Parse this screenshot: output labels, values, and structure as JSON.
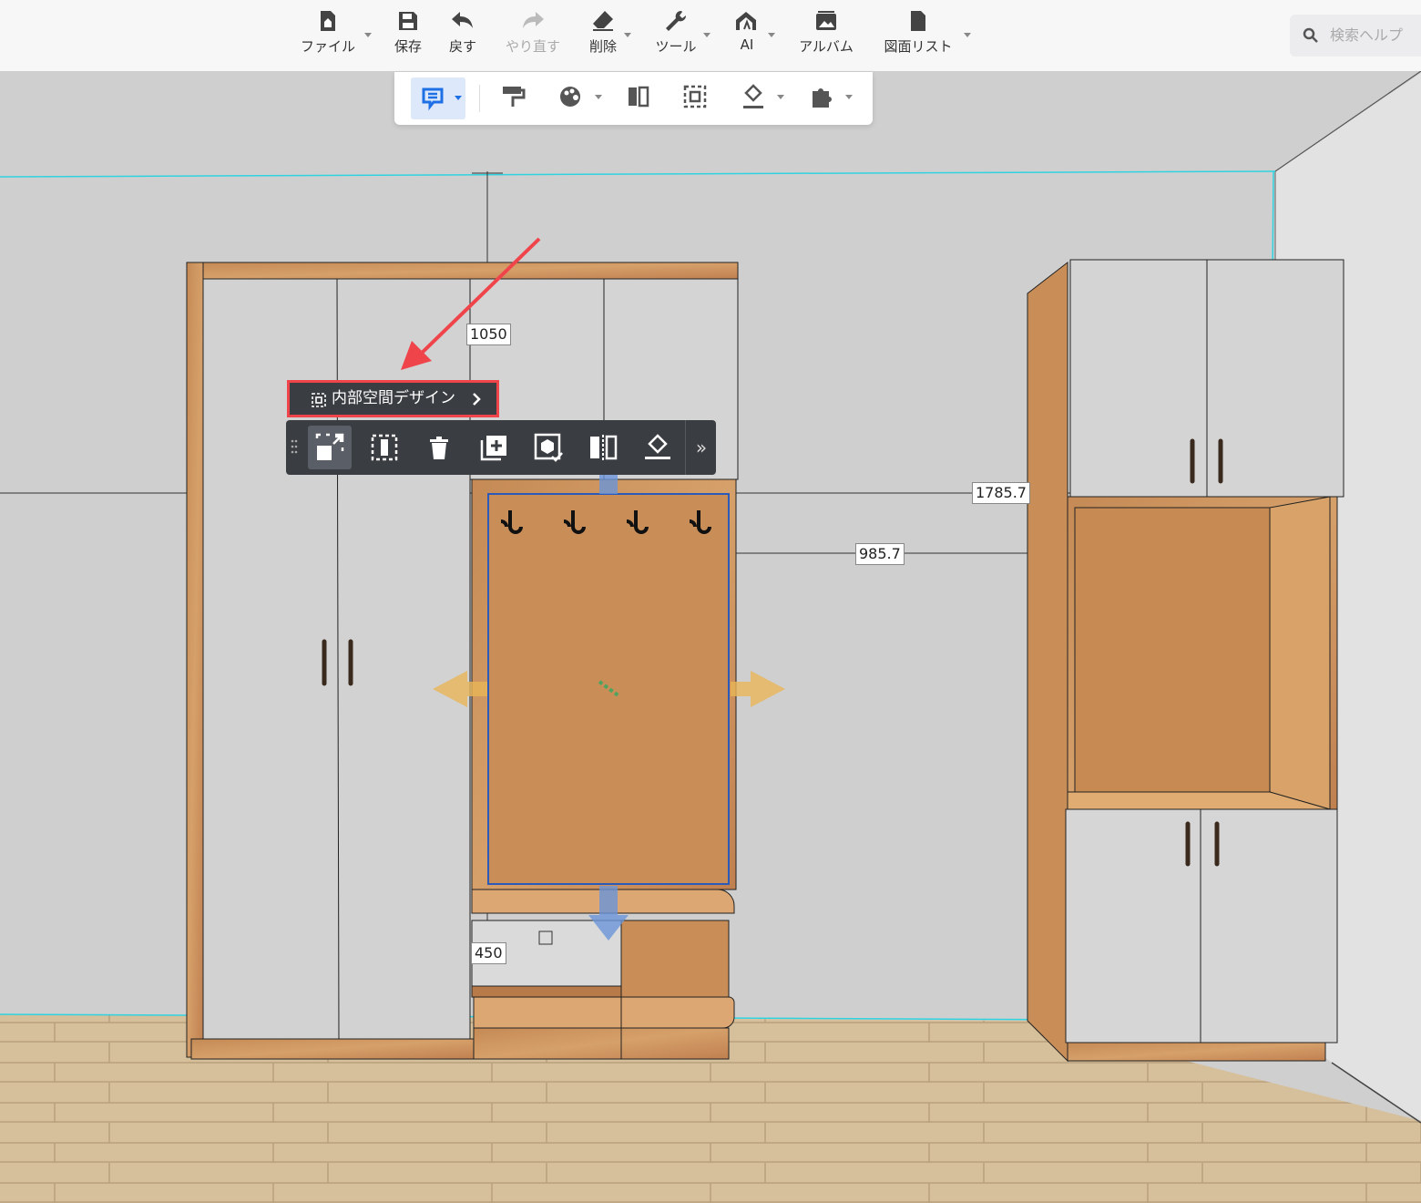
{
  "toolbar": {
    "items": [
      {
        "label": "ファイル",
        "icon": "file-icon"
      },
      {
        "label": "保存",
        "icon": "save-icon"
      },
      {
        "label": "戻す",
        "icon": "undo-icon"
      },
      {
        "label": "やり直す",
        "icon": "redo-icon"
      },
      {
        "label": "削除",
        "icon": "eraser-icon"
      },
      {
        "label": "ツール",
        "icon": "wrench-icon"
      },
      {
        "label": "AI",
        "icon": "ai-icon"
      },
      {
        "label": "アルバム",
        "icon": "album-icon"
      },
      {
        "label": "図面リスト",
        "icon": "document-icon"
      }
    ],
    "search_placeholder": "検索ヘルプ"
  },
  "canvas": {
    "dimensions": {
      "top_height": "1050",
      "right_distance": "1785.7",
      "gap_distance": "985.7",
      "bench_height": "450"
    },
    "inner_design_label": "内部空間デザイン",
    "colors": {
      "wood": "#c98e58",
      "selection": "#2c5ab8",
      "highlight": "#f0444b",
      "guide": "#2fd3e0"
    }
  }
}
